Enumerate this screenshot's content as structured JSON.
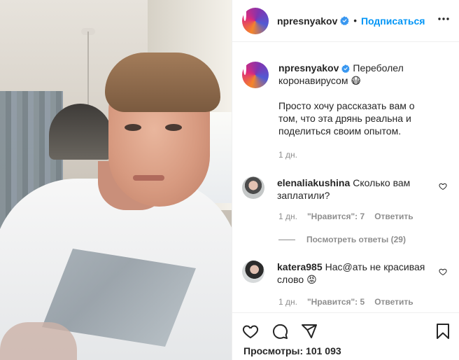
{
  "post": {
    "username": "npresnyakov",
    "follow_label": "Подписаться",
    "separator": "•"
  },
  "caption": {
    "username": "npresnyakov",
    "line1": "Переболел коронавирусом 😷",
    "line2": "Просто хочу рассказать вам о том, что эта дрянь реальна и поделиться своим опытом.",
    "time": "1 дн."
  },
  "comments": [
    {
      "username": "elenaliakushina",
      "text": "Сколько вам заплатили?",
      "time": "1 дн.",
      "likes": "\"Нравится\": 7",
      "reply": "Ответить",
      "view_replies": "Посмотреть ответы (29)"
    },
    {
      "username": "katera985",
      "text": "Нас@ать не красивая слово 😡",
      "time": "1 дн.",
      "likes": "\"Нравится\": 5",
      "reply": "Ответить"
    }
  ],
  "footer": {
    "views": "Просмотры: 101 093"
  },
  "icons": {
    "verified": "verified-badge-icon",
    "more": "more-options-icon",
    "heart": "heart-icon",
    "comment": "comment-icon",
    "share": "share-icon",
    "save": "bookmark-icon"
  },
  "colors": {
    "accent": "#0095f6",
    "muted": "#8e8e8e",
    "text": "#262626",
    "border": "#efefef"
  }
}
